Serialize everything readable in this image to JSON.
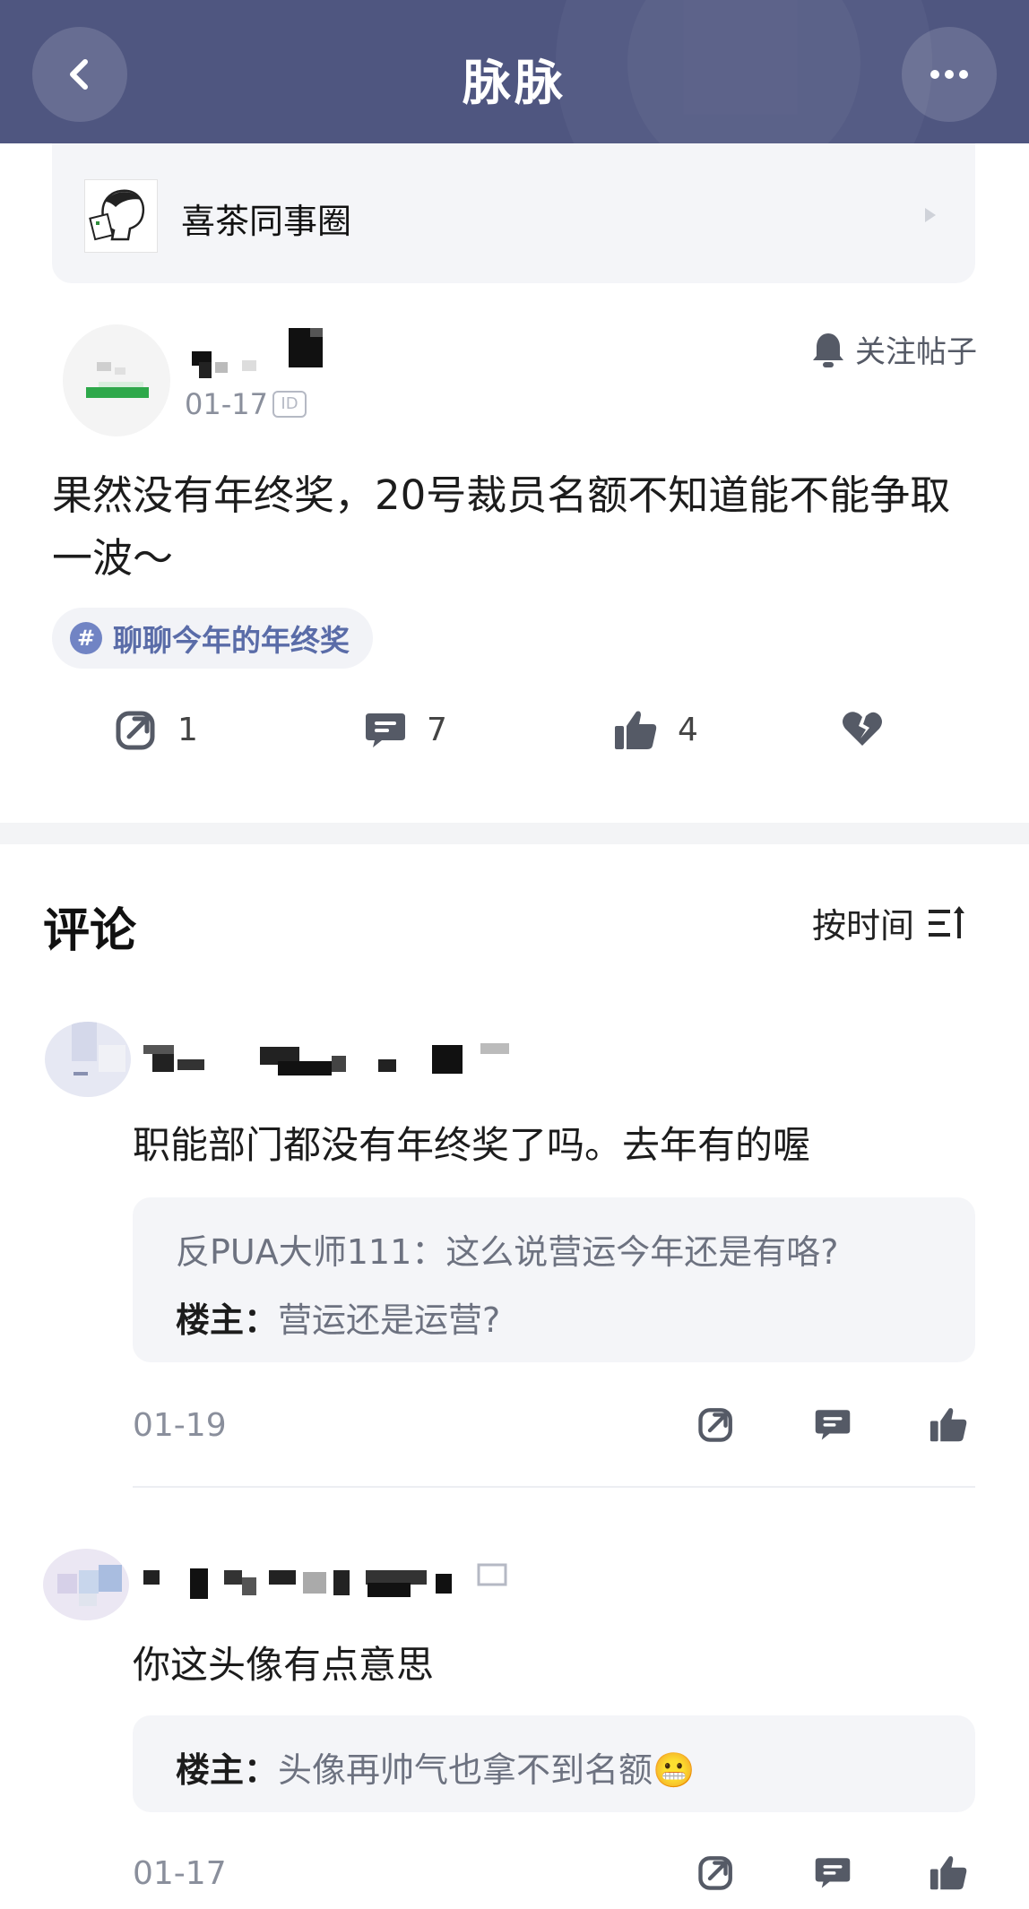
{
  "nav": {
    "title": "脉脉",
    "back_icon": "chevron-left-icon",
    "more_icon": "more-dots-icon"
  },
  "circle": {
    "name": "喜茶同事圈"
  },
  "post": {
    "date": "01-17",
    "id_badge": "ID",
    "follow_label": "关注帖子",
    "text": "果然没有年终奖，20号裁员名额不知道能不能争取一波～",
    "topic_hash": "#",
    "topic": "聊聊今年的年终奖",
    "actions": {
      "share_count": "1",
      "comment_count": "7",
      "like_count": "4"
    }
  },
  "comments_section": {
    "title": "评论",
    "sort_label": "按时间",
    "comments": [
      {
        "text": "职能部门都没有年终奖了吗。去年有的喔",
        "replies": [
          {
            "author": "反PUA大师111：",
            "text": "这么说营运今年还是有咯?"
          },
          {
            "author": "楼主：",
            "text": "营运还是运营?"
          }
        ],
        "date": "01-19"
      },
      {
        "text": "你这头像有点意思",
        "replies": [
          {
            "author": "楼主：",
            "text": "头像再帅气也拿不到名额",
            "emoji": "😬"
          }
        ],
        "date": "01-17"
      }
    ]
  },
  "colors": {
    "nav_bg": "#4f5680",
    "accent": "#5a6ca8",
    "reply_bg": "#f4f5f8"
  }
}
